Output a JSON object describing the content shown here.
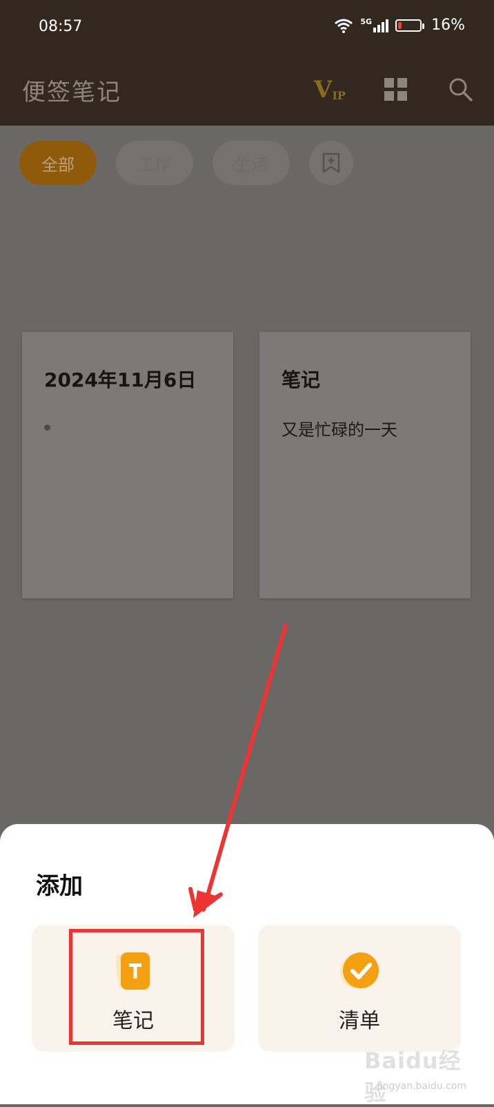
{
  "status_bar": {
    "time": "08:57",
    "network": "5G",
    "battery_percent_label": "16%",
    "battery_level": 0.16,
    "icons": [
      "wifi-icon",
      "signal-icon",
      "battery-icon"
    ]
  },
  "app_bar": {
    "title": "便签笔记",
    "vip_label": "V",
    "vip_sub": "IP",
    "icons": [
      "vip-icon",
      "grid-icon",
      "search-icon"
    ]
  },
  "filters": {
    "items": [
      {
        "label": "全部",
        "selected": true
      },
      {
        "label": "工作",
        "selected": false
      },
      {
        "label": "生活",
        "selected": false
      }
    ],
    "add_icon": "add-bookmark-icon"
  },
  "notes": [
    {
      "title": "2024年11月6日",
      "body": ""
    },
    {
      "title": "笔记",
      "body": "又是忙碌的一天"
    }
  ],
  "add_sheet": {
    "title": "添加",
    "options": [
      {
        "label": "笔记",
        "icon": "note-t-icon"
      },
      {
        "label": "清单",
        "icon": "checklist-check-icon"
      }
    ]
  },
  "watermark": {
    "main": "Baidu经验",
    "sub": "jingyan.baidu.com"
  },
  "colors": {
    "accent": "#f5a010",
    "annotation_red": "#ee3333",
    "dark_bar": "#33281f"
  }
}
